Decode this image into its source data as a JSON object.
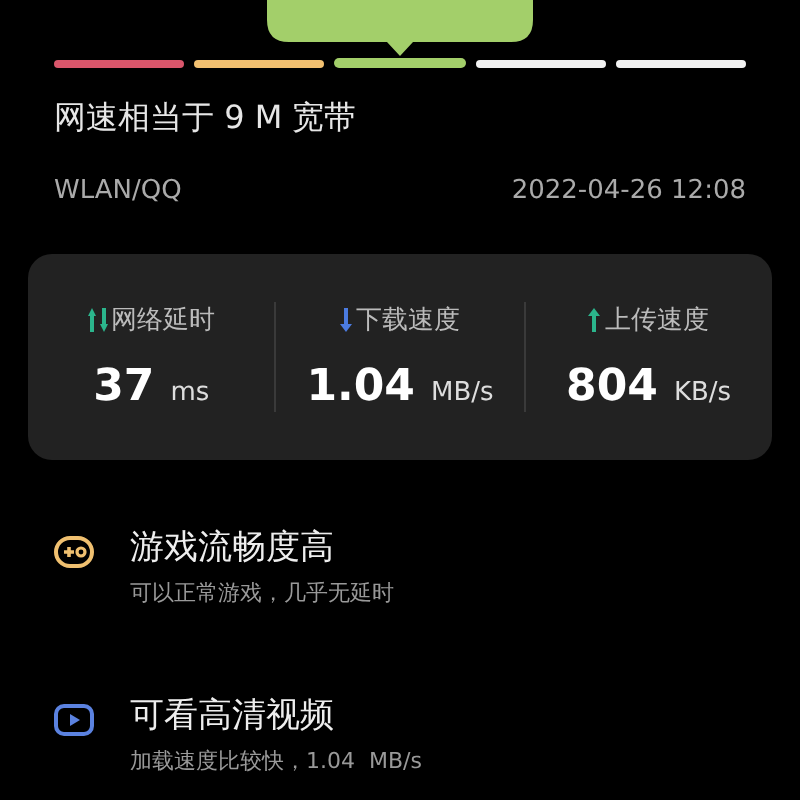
{
  "speed_scale": {
    "segments": [
      {
        "color": "#d9566b",
        "selected": false
      },
      {
        "color": "#f2c070",
        "selected": false
      },
      {
        "color": "#a3cf6a",
        "selected": true
      },
      {
        "color": "#f2f2f2",
        "selected": false
      },
      {
        "color": "#f2f2f2",
        "selected": false
      }
    ]
  },
  "summary": "网速相当于 9 M 宽带",
  "network": "WLAN/QQ",
  "timestamp": "2022-04-26 12:08",
  "stats": [
    {
      "kind": "latency",
      "label": "网络延时",
      "value": "37",
      "unit": "ms"
    },
    {
      "kind": "download",
      "label": "下载速度",
      "value": "1.04",
      "unit": "MB/s"
    },
    {
      "kind": "upload",
      "label": "上传速度",
      "value": "804",
      "unit": "KB/s"
    }
  ],
  "features": [
    {
      "kind": "game",
      "title": "游戏流畅度高",
      "description": "可以正常游戏，几乎无延时"
    },
    {
      "kind": "video",
      "title": "可看高清视频",
      "description": "加载速度比较快，1.04  MB/s"
    }
  ]
}
